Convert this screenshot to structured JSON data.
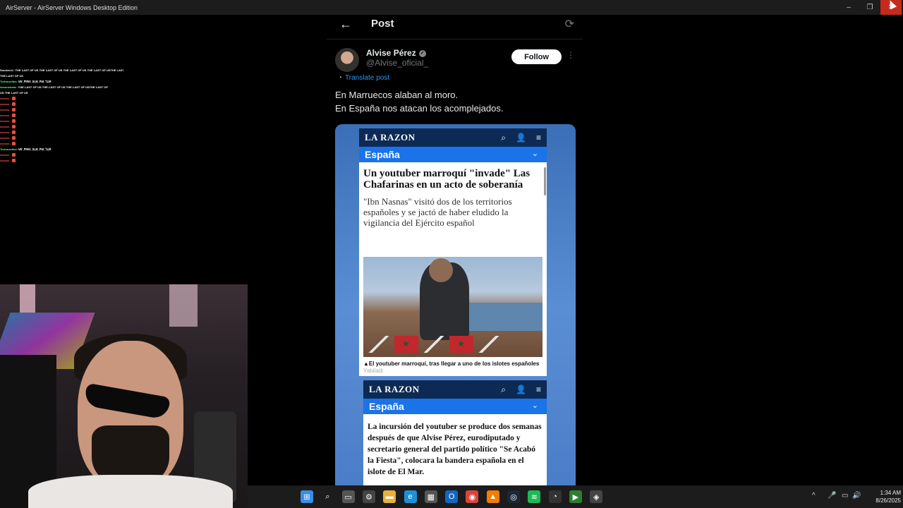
{
  "window": {
    "title": "AirServer - AirServer Windows Desktop Edition",
    "controls": [
      "–",
      "❐",
      "✕"
    ]
  },
  "chat": [
    {
      "user": "Smokers1 :",
      "msg": "THE LAST OF US THE LAST OF US THE LAST OF US THE LAST OF USTHE LAST OF US",
      "color": "white"
    },
    {
      "user": "",
      "msg": "THE LAST OF US",
      "color": "white"
    },
    {
      "user": "Tortouzeitos :",
      "msg": "ꓤꓯ_ꓑꓲꓟꓥ_ꓢꓕꓭ_ꓝꓤꓲ_ꓶꓕꓟ",
      "color": "green"
    },
    {
      "user": "simonebebe :",
      "msg": "THE LAST OF US THE LAST OF US THE LAST OF USTHE LAST OF",
      "color": "green"
    },
    {
      "user": "",
      "msg": "US THE LAST OF US",
      "color": "white"
    },
    {
      "user": "xxxxxx :",
      "msg": "",
      "color": "red"
    },
    {
      "user": "xxxxxx :",
      "msg": "",
      "color": "red"
    },
    {
      "user": "xxxxxx :",
      "msg": "",
      "color": "red"
    },
    {
      "user": "xxxxxx :",
      "msg": "",
      "color": "red"
    },
    {
      "user": "xxxxxx :",
      "msg": "",
      "color": "red"
    },
    {
      "user": "xxxxxx :",
      "msg": "",
      "color": "red"
    },
    {
      "user": "xxxxxx :",
      "msg": "",
      "color": "red"
    },
    {
      "user": "xxxxxx :",
      "msg": "",
      "color": "red"
    },
    {
      "user": "xxxxxx :",
      "msg": "",
      "color": "red"
    },
    {
      "user": "Tortouzeitos :",
      "msg": "ꓤꓯ_ꓑꓲꓟꓥ_ꓢꓕꓭ_ꓝꓤꓲ_ꓶꓕꓟ",
      "color": "green"
    },
    {
      "user": "xxxxxx :",
      "msg": "",
      "color": "red"
    },
    {
      "user": "xxxxxx :",
      "msg": "",
      "color": "red"
    }
  ],
  "post": {
    "header_title": "Post",
    "back_icon": "←",
    "refresh_icon": "⟳",
    "author_name": "Alvise Pérez",
    "author_handle": "@Alvise_oficial_",
    "verified_icon": "✓",
    "follow_label": "Follow",
    "more_icon": "⋮",
    "translate_label": "Translate post",
    "translate_icon": "◔",
    "text": "En Marruecos alaban al moro.\nEn España nos atacan los acomplejados."
  },
  "article1": {
    "logo": "LA RAZON",
    "section": "España",
    "headline": "Un youtuber marroquí \"invade\" Las Chafarinas en un acto de soberanía",
    "subhead": "\"Ibn Nasnas\" visitó dos de los territorios españoles y se jactó de haber eludido la vigilancia del Ejército español",
    "caption": "▲El youtuber marroquí, tras llegar a uno de los islotes españoles",
    "credit": "Yabiladi",
    "icons": [
      "⌕",
      "👤",
      "≡"
    ],
    "chevron": "⌄"
  },
  "article2": {
    "logo": "LA RAZON",
    "section": "España",
    "body": "La incursión del youtuber se produce dos semanas después de que Alvise Pérez, eurodiputado y secretario general del partido político \"Se Acabó la Fiesta\", colocara la bandera española en el islote de El Mar.",
    "icons": [
      "⌕",
      "👤",
      "≡"
    ],
    "chevron": "⌄"
  },
  "taskbar": {
    "time": "1:34 AM",
    "date": "8/26/2025",
    "tray_up": "^",
    "apps": [
      {
        "name": "windows-start-icon",
        "glyph": "⊞",
        "color": "#3a8ee6"
      },
      {
        "name": "search-icon",
        "glyph": "⌕",
        "color": "#1c1c1c"
      },
      {
        "name": "task-view-icon",
        "glyph": "▭",
        "color": "#555"
      },
      {
        "name": "settings-icon",
        "glyph": "⚙",
        "color": "#444"
      },
      {
        "name": "file-explorer-icon",
        "glyph": "▬",
        "color": "#e8b13a"
      },
      {
        "name": "edge-icon",
        "glyph": "e",
        "color": "#1f8fd6"
      },
      {
        "name": "store-icon",
        "glyph": "▦",
        "color": "#555"
      },
      {
        "name": "outlook-icon",
        "glyph": "O",
        "color": "#1565c0"
      },
      {
        "name": "chrome-icon",
        "glyph": "◉",
        "color": "#db4437"
      },
      {
        "name": "vlc-icon",
        "glyph": "▲",
        "color": "#f57c00"
      },
      {
        "name": "steam-icon",
        "glyph": "◎",
        "color": "#1b2838"
      },
      {
        "name": "spotify-icon",
        "glyph": "≋",
        "color": "#1db954"
      },
      {
        "name": "obs-icon",
        "glyph": "◔",
        "color": "#333"
      },
      {
        "name": "media-player-icon",
        "glyph": "▶",
        "color": "#2e7d32"
      },
      {
        "name": "airserver-icon",
        "glyph": "◈",
        "color": "#444"
      }
    ]
  }
}
